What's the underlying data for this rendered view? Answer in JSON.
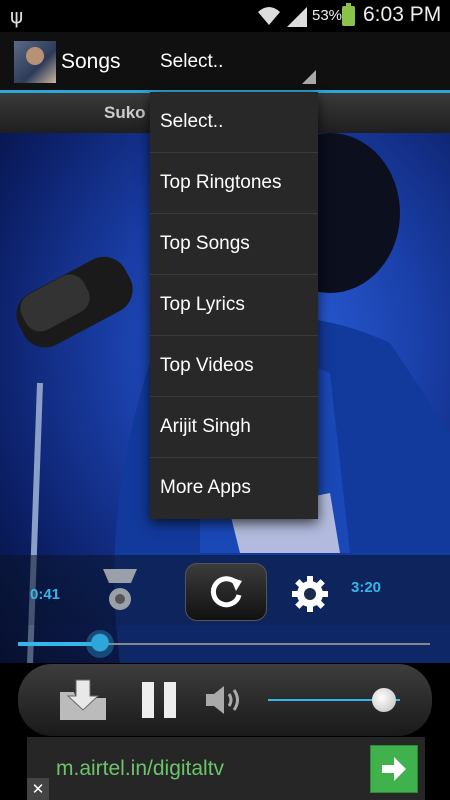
{
  "status_bar": {
    "battery_percent": "53%",
    "time": "6:03 PM",
    "icons": [
      "usb-icon",
      "wifi-icon",
      "signal-icon",
      "battery-charging-icon"
    ]
  },
  "action_bar": {
    "title": "Songs",
    "spinner_value": "Select..",
    "accent_color": "#2ea7d8"
  },
  "now_playing": {
    "title_partial": "Suko"
  },
  "dropdown": {
    "items": [
      "Select..",
      "Top Ringtones",
      "Top Songs",
      "Top Lyrics",
      "Top Videos",
      "Arijit Singh",
      "More Apps"
    ]
  },
  "player": {
    "elapsed": "0:41",
    "duration": "3:20",
    "progress_fraction": 0.2,
    "volume_fraction": 0.88,
    "icons": [
      "shuffle-icon",
      "repeat-icon",
      "gear-icon",
      "download-icon",
      "pause-icon",
      "volume-icon"
    ]
  },
  "ad": {
    "text": "m.airtel.in/digitaltv",
    "close_label": "✕",
    "button_color": "#3fb24d"
  }
}
